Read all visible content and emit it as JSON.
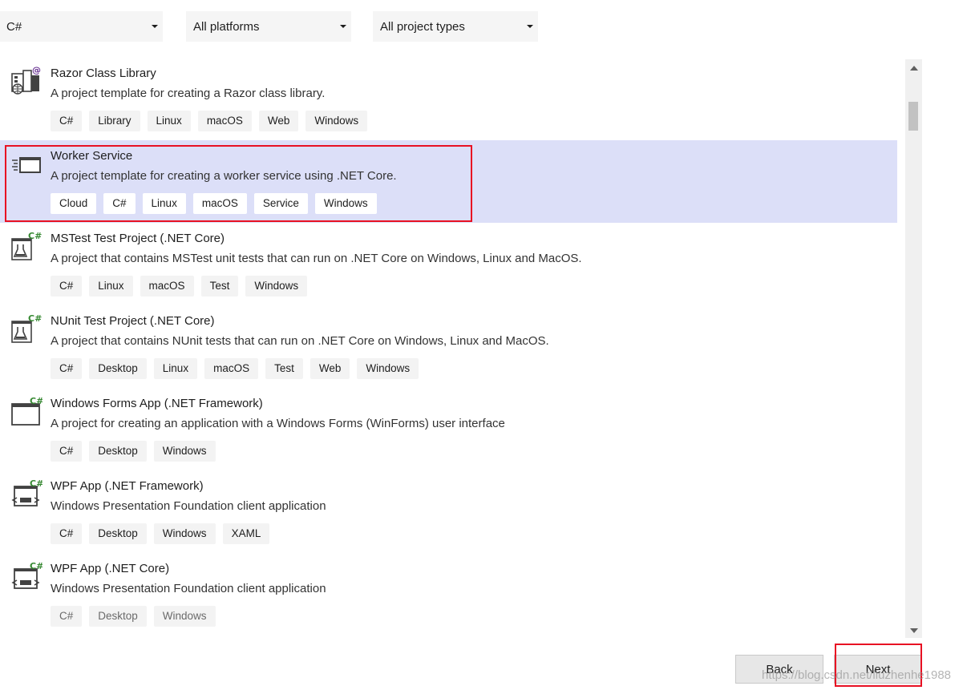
{
  "filters": {
    "language": "C#",
    "platform": "All platforms",
    "project_type": "All project types"
  },
  "templates": [
    {
      "icon": "razor-class-library-icon",
      "title": "Razor Class Library",
      "description": "A project template for creating a Razor class library.",
      "tags": [
        "C#",
        "Library",
        "Linux",
        "macOS",
        "Web",
        "Windows"
      ],
      "selected": false
    },
    {
      "icon": "worker-service-icon",
      "title": "Worker Service",
      "description": "A project template for creating a worker service using .NET Core.",
      "tags": [
        "Cloud",
        "C#",
        "Linux",
        "macOS",
        "Service",
        "Windows"
      ],
      "selected": true
    },
    {
      "icon": "mstest-project-icon",
      "title": "MSTest Test Project (.NET Core)",
      "description": "A project that contains MSTest unit tests that can run on .NET Core on Windows, Linux and MacOS.",
      "tags": [
        "C#",
        "Linux",
        "macOS",
        "Test",
        "Windows"
      ],
      "selected": false
    },
    {
      "icon": "nunit-project-icon",
      "title": "NUnit Test Project (.NET Core)",
      "description": "A project that contains NUnit tests that can run on .NET Core on Windows, Linux and MacOS.",
      "tags": [
        "C#",
        "Desktop",
        "Linux",
        "macOS",
        "Test",
        "Web",
        "Windows"
      ],
      "selected": false
    },
    {
      "icon": "windows-forms-app-icon",
      "title": "Windows Forms App (.NET Framework)",
      "description": "A project for creating an application with a Windows Forms (WinForms) user interface",
      "tags": [
        "C#",
        "Desktop",
        "Windows"
      ],
      "selected": false
    },
    {
      "icon": "wpf-app-icon",
      "title": "WPF App (.NET Framework)",
      "description": "Windows Presentation Foundation client application",
      "tags": [
        "C#",
        "Desktop",
        "Windows",
        "XAML"
      ],
      "selected": false
    },
    {
      "icon": "wpf-app-icon",
      "title": "WPF App (.NET Core)",
      "description": "Windows Presentation Foundation client application",
      "tags": [
        "C#",
        "Desktop",
        "Windows"
      ],
      "selected": false
    }
  ],
  "buttons": {
    "back": "Back",
    "next": "Next"
  },
  "watermark": "https://blog.csdn.net/liuzhenhe1988",
  "colors": {
    "selected_row": "#dcdff8",
    "highlight_border": "#e81123",
    "csharp_badge": "#388a34"
  }
}
